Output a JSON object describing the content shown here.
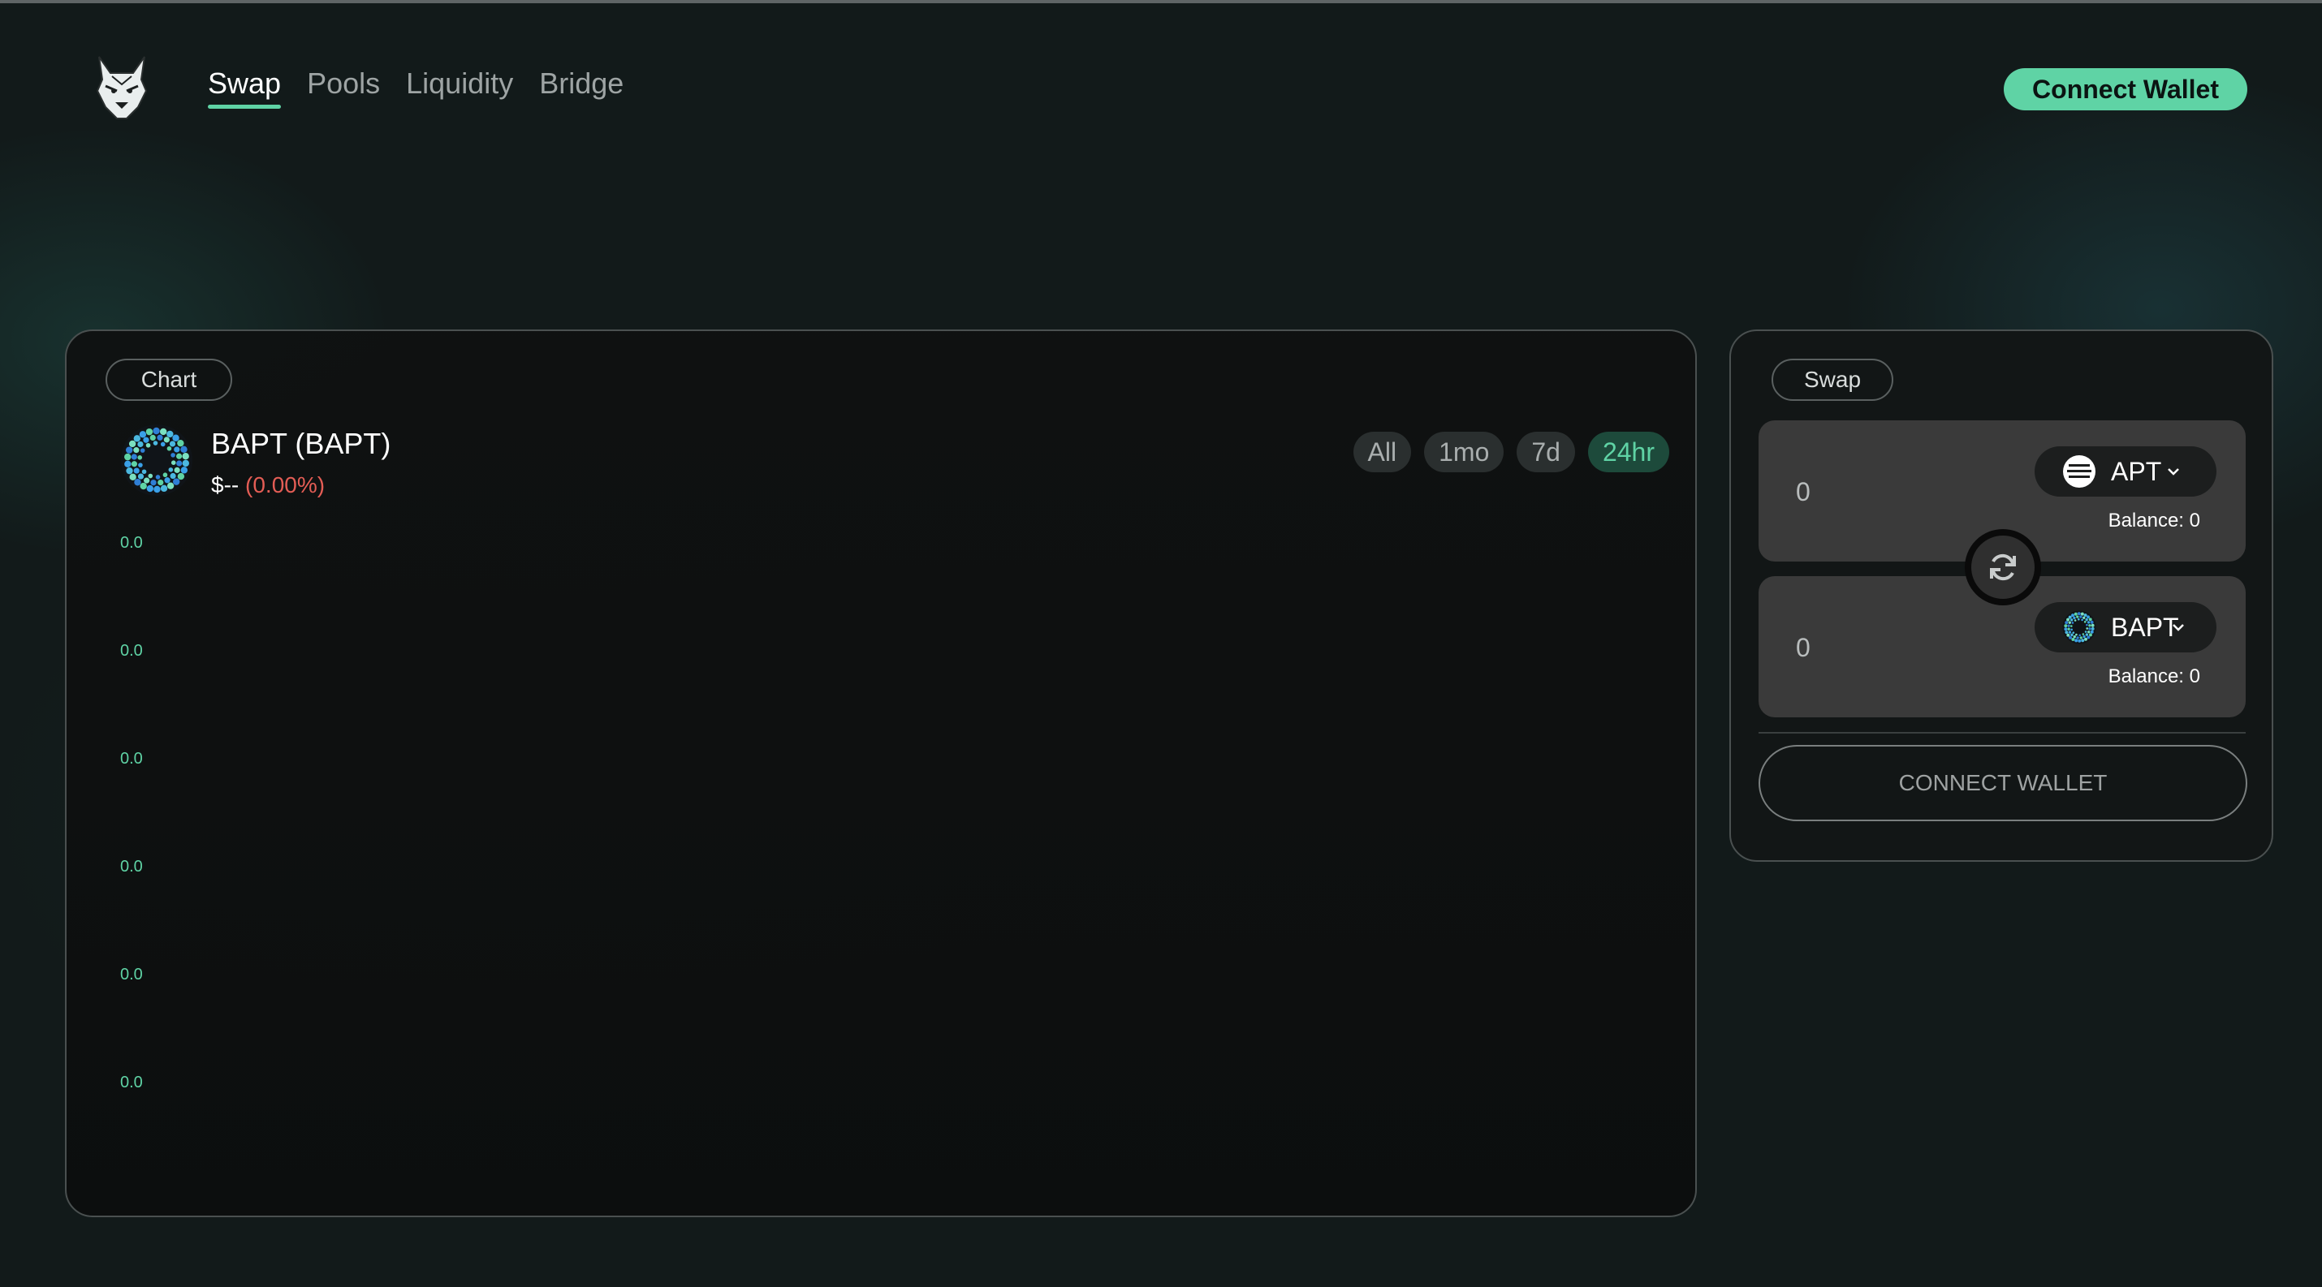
{
  "header": {
    "logo_icon": "wolf-head-logo",
    "nav": [
      {
        "label": "Swap",
        "active": true
      },
      {
        "label": "Pools",
        "active": false
      },
      {
        "label": "Liquidity",
        "active": false
      },
      {
        "label": "Bridge",
        "active": false
      }
    ],
    "connect_label": "Connect Wallet"
  },
  "chart_panel": {
    "tab_label": "Chart",
    "token": {
      "name": "BAPT (BAPT)",
      "price": "$--",
      "change": "(0.00%)",
      "icon": "bapt-token-icon"
    },
    "ranges": [
      {
        "label": "All",
        "active": false
      },
      {
        "label": "1mo",
        "active": false
      },
      {
        "label": "7d",
        "active": false
      },
      {
        "label": "24hr",
        "active": true
      }
    ],
    "y_ticks": [
      "0.0",
      "0.0",
      "0.0",
      "0.0",
      "0.0",
      "0.0"
    ]
  },
  "swap_panel": {
    "tab_label": "Swap",
    "from": {
      "amount": "0",
      "token": "APT",
      "token_icon": "apt-token-icon",
      "balance": "Balance: 0"
    },
    "to": {
      "amount": "0",
      "token": "BAPT",
      "token_icon": "bapt-token-icon",
      "balance": "Balance: 0"
    },
    "swap_icon": "swap-direction-icon",
    "connect_label": "CONNECT WALLET"
  },
  "colors": {
    "accent": "#5fd3a5",
    "negative": "#e35d55",
    "background": "#121a1a",
    "card": "#0f1111"
  }
}
